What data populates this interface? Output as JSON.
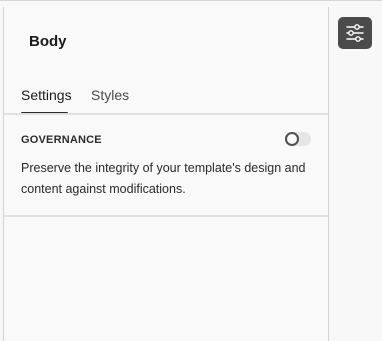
{
  "panel": {
    "title": "Body",
    "tabs": [
      {
        "label": "Settings",
        "active": true
      },
      {
        "label": "Styles",
        "active": false
      }
    ]
  },
  "governance": {
    "heading": "GOVERNANCE",
    "description": "Preserve the integrity of your template's design and content against modifications.",
    "toggle_on": false
  },
  "toolbar": {
    "settings_icon": "sliders-icon"
  },
  "colors": {
    "button_bg": "#4b4b4b",
    "panel_bg": "#f9f9f9"
  }
}
